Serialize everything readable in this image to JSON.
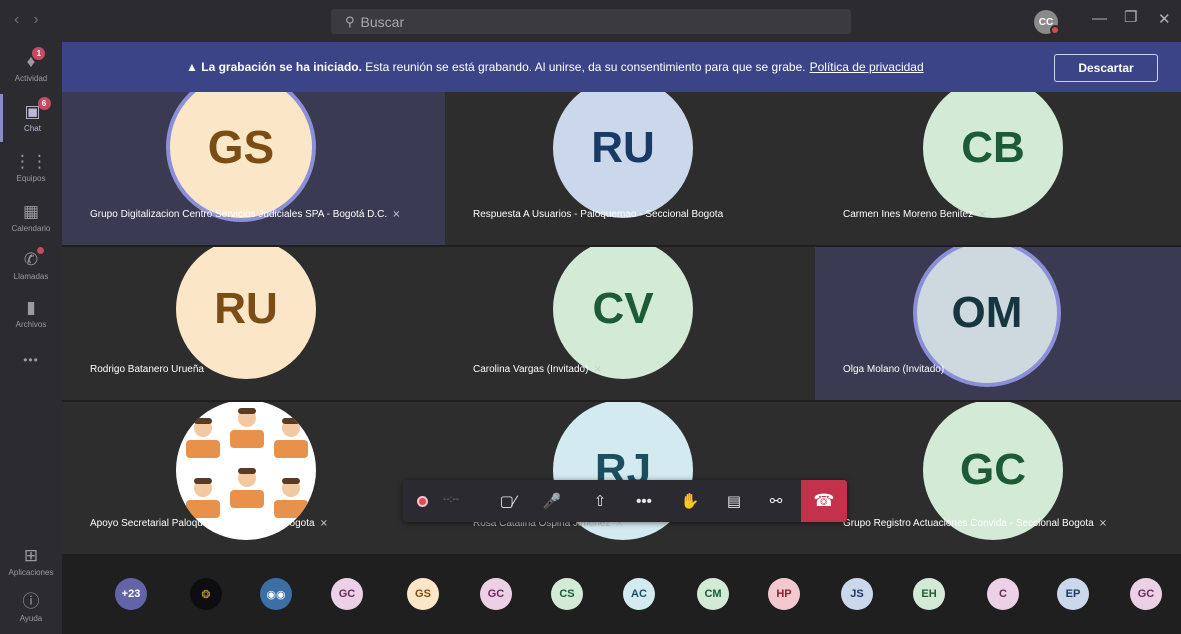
{
  "titlebar": {
    "search_placeholder": "Buscar",
    "user_initials": "CC"
  },
  "rail": [
    {
      "label": "Actividad",
      "badge": "1",
      "icon": "bell-icon"
    },
    {
      "label": "Chat",
      "badge": "6",
      "icon": "chat-icon"
    },
    {
      "label": "Equipos",
      "badge": "",
      "icon": "teams-icon"
    },
    {
      "label": "Calendario",
      "badge": "",
      "icon": "calendar-icon"
    },
    {
      "label": "Llamadas",
      "badge": "",
      "icon": "phone-icon"
    },
    {
      "label": "Archivos",
      "badge": "",
      "icon": "file-icon"
    }
  ],
  "rail_bottom": [
    {
      "label": "Aplicaciones",
      "icon": "apps-icon"
    },
    {
      "label": "Ayuda",
      "icon": "help-icon"
    }
  ],
  "banner": {
    "bold": "La grabación se ha iniciado.",
    "text": "Esta reunión se está grabando. Al unirse, da su consentimiento para que se grabe.",
    "link": "Política de privacidad",
    "dismiss": "Descartar"
  },
  "tiles": [
    {
      "initials": "GS",
      "name": "Grupo Digitalizacion Centro Servicios Judiciales SPA - Bogotá D.C.",
      "bg": "#fbe6c7",
      "fg": "#7a4d14",
      "muted": true
    },
    {
      "initials": "RU",
      "name": "Respuesta A Usuarios - Paloquemao - Seccional Bogota",
      "bg": "#cbd8ec",
      "fg": "#193a65",
      "muted": false
    },
    {
      "initials": "CB",
      "name": "Carmen Ines Moreno Benitez",
      "bg": "#d3ead7",
      "fg": "#1c5b36",
      "muted": true
    },
    {
      "initials": "RU",
      "name": "Rodrigo Batanero Urueña",
      "bg": "#fbe6c7",
      "fg": "#7a4d14",
      "muted": false
    },
    {
      "initials": "CV",
      "name": "Carolina Vargas (Invitado)",
      "bg": "#d3ead7",
      "fg": "#1c5b36",
      "muted": true
    },
    {
      "initials": "OM",
      "name": "Olga Molano (Invitado)",
      "bg": "#cdd9df",
      "fg": "#17353f",
      "muted": false
    },
    {
      "initials": "",
      "name": "Apoyo Secretarial Paloquemao - Seccional Bogota",
      "bg": "#ffffff",
      "fg": "#333333",
      "muted": true
    },
    {
      "initials": "RJ",
      "name": "Rosa Catalina Ospina Jimenez",
      "bg": "#d2eaf0",
      "fg": "#1b4f5d",
      "muted": true
    },
    {
      "initials": "GC",
      "name": "Grupo Registro Actuaciones Convida - Seccional Bogota",
      "bg": "#d3ead7",
      "fg": "#1c5b36",
      "muted": true
    }
  ],
  "toolbar": {
    "timer": "--:--"
  },
  "strip": [
    {
      "label": "+23",
      "bg": "#6264a7",
      "fg": "#ffffff"
    },
    {
      "label": "",
      "bg": "#0e0e12",
      "fg": "#d4a93a"
    },
    {
      "label": "",
      "bg": "#3b6fa6",
      "fg": "#ffffff"
    },
    {
      "label": "GC",
      "bg": "#ecd0e6",
      "fg": "#6a2a5e"
    },
    {
      "label": "GS",
      "bg": "#fbe6c7",
      "fg": "#7a4d14"
    },
    {
      "label": "GC",
      "bg": "#ecd0e6",
      "fg": "#6a2a5e"
    },
    {
      "label": "CS",
      "bg": "#d3ead7",
      "fg": "#1c5b36"
    },
    {
      "label": "AC",
      "bg": "#d2eaf0",
      "fg": "#1b4f5d"
    },
    {
      "label": "CM",
      "bg": "#d3ead7",
      "fg": "#1c5b36"
    },
    {
      "label": "HP",
      "bg": "#f3c8cf",
      "fg": "#8a1f33"
    },
    {
      "label": "JS",
      "bg": "#cbd8ec",
      "fg": "#193a65"
    },
    {
      "label": "EH",
      "bg": "#d3ead7",
      "fg": "#1c5b36"
    },
    {
      "label": "C",
      "bg": "#ecd0e6",
      "fg": "#6a2a5e"
    },
    {
      "label": "EP",
      "bg": "#cbd8ec",
      "fg": "#193a65"
    },
    {
      "label": "GC",
      "bg": "#ecd0e6",
      "fg": "#6a2a5e"
    }
  ]
}
